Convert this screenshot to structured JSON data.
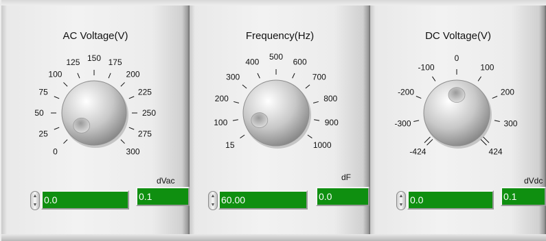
{
  "panels": [
    {
      "title": "AC Voltage(V)",
      "value": "0.0",
      "increment": "0.1",
      "increment_unit": "dVac",
      "dial_min": 0,
      "dial_max": 300,
      "dial_value": 0,
      "ticks": [
        {
          "label": "0",
          "value": 0
        },
        {
          "label": "25",
          "value": 25
        },
        {
          "label": "50",
          "value": 50
        },
        {
          "label": "75",
          "value": 75
        },
        {
          "label": "100",
          "value": 100
        },
        {
          "label": "125",
          "value": 125
        },
        {
          "label": "150",
          "value": 150
        },
        {
          "label": "175",
          "value": 175
        },
        {
          "label": "200",
          "value": 200
        },
        {
          "label": "225",
          "value": 225
        },
        {
          "label": "250",
          "value": 250
        },
        {
          "label": "275",
          "value": 275
        },
        {
          "label": "300",
          "value": 300
        }
      ]
    },
    {
      "title": "Frequency(Hz)",
      "value": "60.00",
      "increment": "0.0",
      "increment_unit": "dF",
      "dial_min": 15,
      "dial_max": 1000,
      "dial_value": 60,
      "ticks": [
        {
          "label": "15",
          "value": 15
        },
        {
          "label": "100",
          "value": 100
        },
        {
          "label": "200",
          "value": 200
        },
        {
          "label": "300",
          "value": 300
        },
        {
          "label": "400",
          "value": 400
        },
        {
          "label": "500",
          "value": 500
        },
        {
          "label": "600",
          "value": 600
        },
        {
          "label": "700",
          "value": 700
        },
        {
          "label": "800",
          "value": 800
        },
        {
          "label": "900",
          "value": 900
        },
        {
          "label": "1000",
          "value": 1000
        }
      ]
    },
    {
      "title": "DC Voltage(V)",
      "value": "0.0",
      "increment": "0.1",
      "increment_unit": "dVdc",
      "dial_min": -424,
      "dial_max": 424,
      "dial_value": 0,
      "ticks": [
        {
          "label": "-424",
          "value": -424
        },
        {
          "label": "-300",
          "value": -300
        },
        {
          "label": "-200",
          "value": -200
        },
        {
          "label": "-100",
          "value": -100
        },
        {
          "label": "0",
          "value": 0
        },
        {
          "label": "100",
          "value": 100
        },
        {
          "label": "200",
          "value": 200
        },
        {
          "label": "300",
          "value": 300
        },
        {
          "label": "424",
          "value": 424
        }
      ]
    }
  ],
  "colors": {
    "field_bg": "#0f8f10",
    "field_text": "#ffffff"
  },
  "icons": {
    "spinner": "up-down-arrows-icon"
  }
}
